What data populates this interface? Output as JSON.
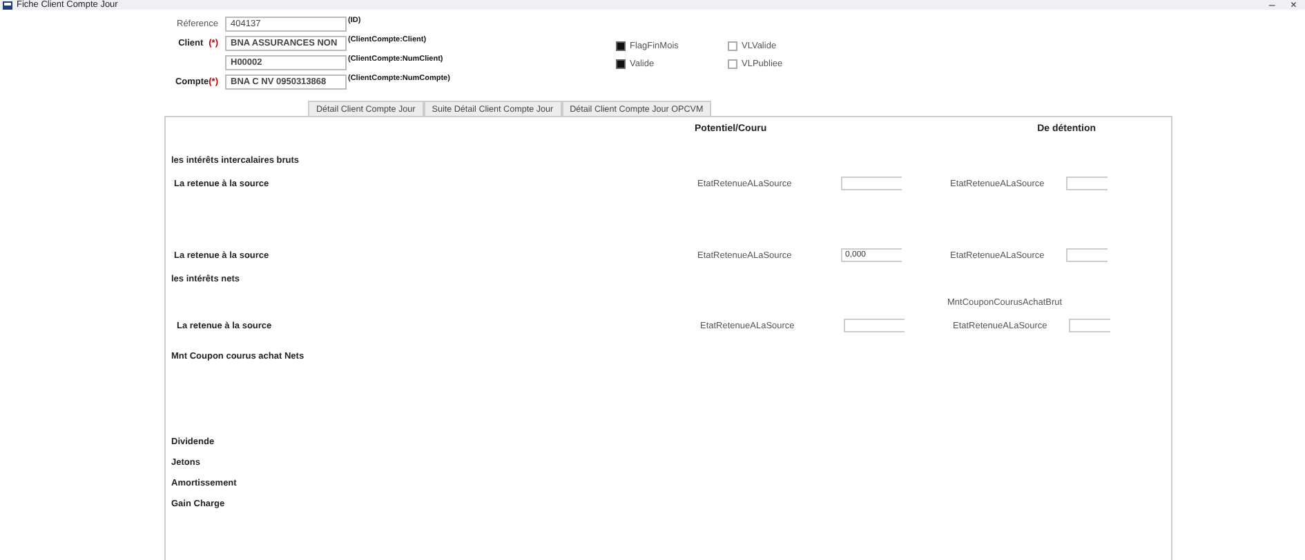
{
  "window": {
    "title": "Fiche Client Compte Jour",
    "controls": [
      "–",
      "×"
    ]
  },
  "header_fields": [
    {
      "label": "Réference",
      "value": "404137",
      "hint": "(ID)",
      "kind": "plain"
    },
    {
      "label": "Client",
      "required_mark": "(*)",
      "value": "BNA ASSURANCES NON",
      "hint": "(ClientCompte:Client)",
      "kind": "bold"
    },
    {
      "value": "H00002",
      "hint": "(ClientCompte:NumClient)",
      "kind": "bold"
    },
    {
      "label": "Compte",
      "required_mark": "(*)",
      "value": "BNA C NV 0950313868",
      "hint": "(ClientCompte:NumCompte)",
      "kind": "bold"
    }
  ],
  "checkboxes": [
    {
      "label": "FlagFinMois",
      "checked": true
    },
    {
      "label": "VLValide",
      "checked": false
    },
    {
      "label": "Valide",
      "checked": true
    },
    {
      "label": "VLPubliee",
      "checked": false
    }
  ],
  "tabs": [
    {
      "label": "Détail Client Compte Jour",
      "selected": false
    },
    {
      "label": "Suite Détail Client Compte Jour",
      "selected": false
    },
    {
      "label": "Détail Client Compte Jour OPCVM",
      "selected": false
    }
  ],
  "columns": [
    "Potentiel/Couru",
    "De détention"
  ],
  "rows": [
    {
      "kind": "heading",
      "label": "les intérêts intercalaires bruts"
    },
    {
      "kind": "retenue",
      "label": "La retenue à la source",
      "left_label": "EtatRetenueALaSource",
      "left_value": "",
      "right_label": "EtatRetenueALaSource",
      "right_value": ""
    },
    {
      "kind": "retenue",
      "label": "La retenue à la source",
      "left_label": "EtatRetenueALaSource",
      "left_value": "0,000",
      "right_label": "EtatRetenueALaSource",
      "right_value": ""
    },
    {
      "kind": "heading",
      "label": "les intérêts nets"
    },
    {
      "kind": "note",
      "note": "MntCouponCourusAchatBrut"
    },
    {
      "kind": "retenue",
      "label": "La retenue à la source",
      "left_label": "EtatRetenueALaSource",
      "left_value": "",
      "right_label": "EtatRetenueALaSource",
      "right_value": ""
    },
    {
      "kind": "heading",
      "label": "Mnt Coupon courus achat Nets"
    },
    {
      "kind": "heading",
      "label": "Dividende"
    },
    {
      "kind": "heading",
      "label": "Jetons"
    },
    {
      "kind": "heading",
      "label": "Amortissement"
    },
    {
      "kind": "heading",
      "label": "Gain Charge"
    }
  ]
}
